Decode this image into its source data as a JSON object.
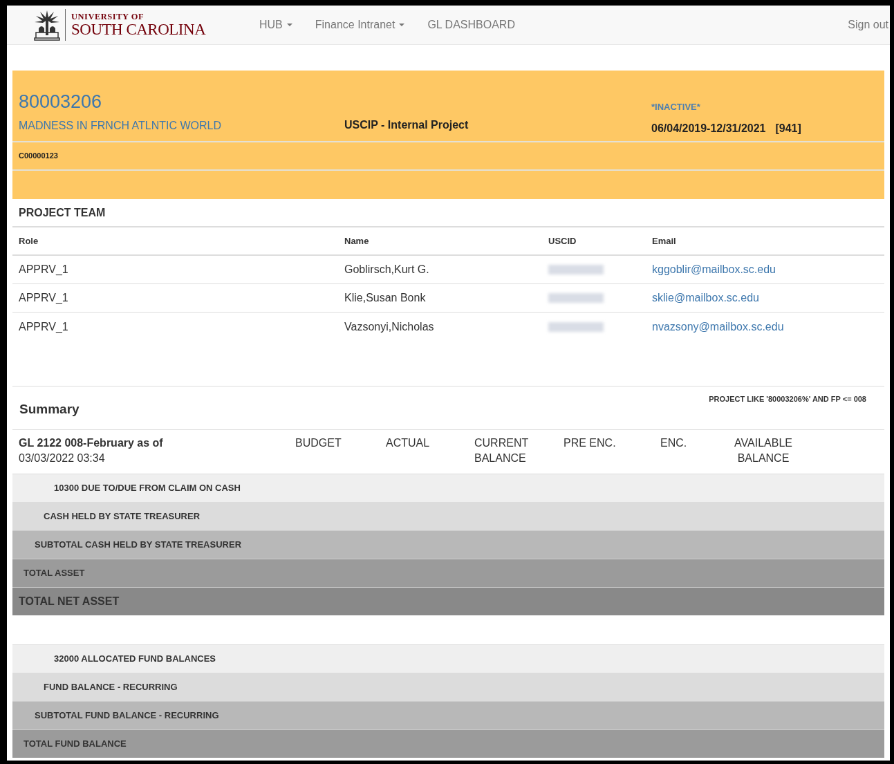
{
  "navbar": {
    "logo": {
      "line_1": "UNIVERSITY OF",
      "line_2": "SOUTH CAROLINA"
    },
    "menu": [
      {
        "label": "HUB",
        "dropdown": true
      },
      {
        "label": "Finance Intranet",
        "dropdown": true
      },
      {
        "label": "GL DASHBOARD",
        "dropdown": false
      }
    ],
    "sign_out": "Sign out"
  },
  "project": {
    "number": "80003206",
    "title": "MADNESS IN FRNCH ATLNTIC WORLD",
    "type": "USCIP - Internal Project",
    "status": "*INACTIVE*",
    "dates": "06/04/2019-12/31/2021",
    "code": "[941]",
    "contract": "C00000123"
  },
  "project_team": {
    "title": "PROJECT TEAM",
    "columns": [
      "Role",
      "Name",
      "USCID",
      "Email"
    ],
    "rows": [
      {
        "role": "APPRV_1",
        "name": "Goblirsch,Kurt G.",
        "email": "kggoblir@mailbox.sc.edu"
      },
      {
        "role": "APPRV_1",
        "name": "Klie,Susan Bonk",
        "email": "sklie@mailbox.sc.edu"
      },
      {
        "role": "APPRV_1",
        "name": "Vazsonyi,Nicholas",
        "email": "nvazsony@mailbox.sc.edu"
      }
    ]
  },
  "summary": {
    "title": "Summary",
    "query": "PROJECT LIKE '80003206%' AND FP <= 008",
    "period": "GL 2122 008-February as of",
    "timestamp": "03/03/2022 03:34",
    "columns": [
      "BUDGET",
      "ACTUAL",
      "CURRENT BALANCE",
      "PRE ENC.",
      "ENC.",
      "AVAILABLE BALANCE"
    ],
    "groups": [
      {
        "rows": [
          {
            "kind": "account",
            "label": "10300 DUE TO/DUE FROM CLAIM ON CASH"
          },
          {
            "kind": "line",
            "label": "CASH HELD BY STATE TREASURER"
          },
          {
            "kind": "subtotal",
            "label": "SUBTOTAL CASH HELD BY STATE TREASURER"
          },
          {
            "kind": "total",
            "label": "TOTAL ASSET"
          },
          {
            "kind": "grand",
            "label": "TOTAL NET ASSET"
          }
        ]
      },
      {
        "rows": [
          {
            "kind": "account",
            "label": "32000 ALLOCATED FUND BALANCES"
          },
          {
            "kind": "line",
            "label": "FUND BALANCE - RECURRING"
          },
          {
            "kind": "subtotal",
            "label": "SUBTOTAL FUND BALANCE - RECURRING"
          },
          {
            "kind": "total",
            "label": "TOTAL FUND BALANCE"
          }
        ]
      }
    ]
  }
}
